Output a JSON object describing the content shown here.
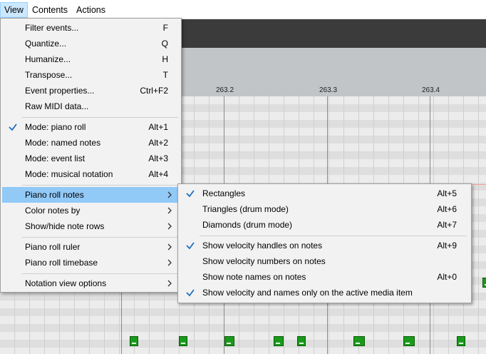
{
  "menubar": {
    "items": [
      {
        "label": "View"
      },
      {
        "label": "Contents"
      },
      {
        "label": "Actions"
      }
    ]
  },
  "ruler": {
    "ticks": [
      "263.2",
      "263.3",
      "263.4"
    ]
  },
  "view_menu": {
    "items": [
      {
        "label": "Filter events...",
        "shortcut": "F"
      },
      {
        "label": "Quantize...",
        "shortcut": "Q"
      },
      {
        "label": "Humanize...",
        "shortcut": "H"
      },
      {
        "label": "Transpose...",
        "shortcut": "T"
      },
      {
        "label": "Event properties...",
        "shortcut": "Ctrl+F2"
      },
      {
        "label": "Raw MIDI data...",
        "shortcut": ""
      },
      {
        "label": "Mode: piano roll",
        "shortcut": "Alt+1",
        "checked": true
      },
      {
        "label": "Mode: named notes",
        "shortcut": "Alt+2"
      },
      {
        "label": "Mode: event list",
        "shortcut": "Alt+3"
      },
      {
        "label": "Mode: musical notation",
        "shortcut": "Alt+4"
      },
      {
        "label": "Piano roll notes",
        "submenu": true,
        "highlighted": true
      },
      {
        "label": "Color notes by",
        "submenu": true
      },
      {
        "label": "Show/hide note rows",
        "submenu": true
      },
      {
        "label": "Piano roll ruler",
        "submenu": true
      },
      {
        "label": "Piano roll timebase",
        "submenu": true
      },
      {
        "label": "Notation view options",
        "submenu": true
      }
    ]
  },
  "piano_roll_notes_submenu": {
    "items": [
      {
        "label": "Rectangles",
        "shortcut": "Alt+5",
        "checked": true
      },
      {
        "label": "Triangles (drum mode)",
        "shortcut": "Alt+6"
      },
      {
        "label": "Diamonds (drum mode)",
        "shortcut": "Alt+7"
      },
      {
        "label": "Show velocity handles on notes",
        "shortcut": "Alt+9",
        "checked": true
      },
      {
        "label": "Show velocity numbers on notes",
        "shortcut": ""
      },
      {
        "label": "Show note names on notes",
        "shortcut": "Alt+0"
      },
      {
        "label": "Show velocity and names only on the active media item",
        "shortcut": "",
        "checked": true
      }
    ]
  },
  "colors": {
    "highlight": "#91c9f7",
    "check": "#1f6fc0",
    "note": "#1a9a1a"
  },
  "icons": {
    "check": "checkmark-icon",
    "submenu": "chevron-right-icon"
  }
}
